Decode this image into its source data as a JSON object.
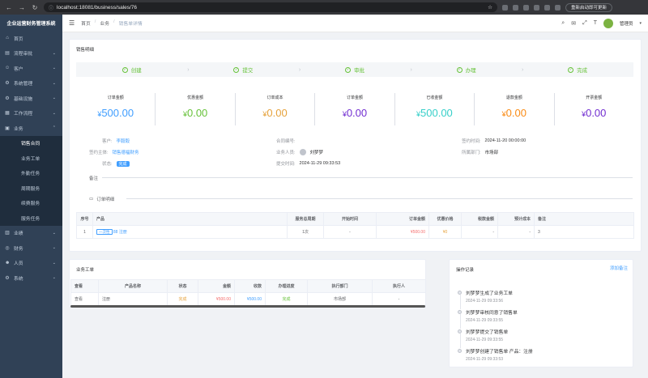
{
  "browser": {
    "url": "localhost:18081/business/sales/76",
    "update_label": "重新启动即可更新"
  },
  "sidebar": {
    "title": "企业运营财务管理系统",
    "items": [
      {
        "label": "首页",
        "icon": "home-icon"
      },
      {
        "label": "流程审批",
        "icon": "flow-icon"
      },
      {
        "label": "客户",
        "icon": "user-icon"
      },
      {
        "label": "系统管理",
        "icon": "gear-icon"
      },
      {
        "label": "基础设施",
        "icon": "gear-icon"
      },
      {
        "label": "工作流程",
        "icon": "flow-icon"
      },
      {
        "label": "业务",
        "icon": "folder-icon"
      }
    ],
    "sub_items": [
      "销售合同",
      "业务工单",
      "外勤任务",
      "周期服务",
      "续费服务",
      "服务任务"
    ],
    "bottom_items": [
      {
        "label": "业绩",
        "icon": "chart-icon"
      },
      {
        "label": "财务",
        "icon": "money-icon"
      },
      {
        "label": "人员",
        "icon": "people-icon"
      },
      {
        "label": "系统",
        "icon": "gear-icon"
      }
    ]
  },
  "header": {
    "breadcrumb": [
      "首页",
      "业务",
      "销售单详情"
    ],
    "user_name": "管理员"
  },
  "sales": {
    "card_title": "销售明细",
    "steps": [
      "创建",
      "提交",
      "审批",
      "办理",
      "完成"
    ],
    "amounts": [
      {
        "label": "订单金额",
        "currency": "¥",
        "value": "500.00",
        "color": "#409eff"
      },
      {
        "label": "优惠金额",
        "currency": "¥",
        "value": "0.00",
        "color": "#67c23a"
      },
      {
        "label": "订单成本",
        "currency": "¥",
        "value": "0.00",
        "color": "#e6a23c"
      },
      {
        "label": "订单金额",
        "currency": "¥",
        "value": "0.00",
        "color": "#722ed1"
      },
      {
        "label": "已收金额",
        "currency": "¥",
        "value": "500.00",
        "color": "#36cfc9"
      },
      {
        "label": "退款金额",
        "currency": "¥",
        "value": "0.00",
        "color": "#fa8c16"
      },
      {
        "label": "开票金额",
        "currency": "¥",
        "value": "0.00",
        "color": "#722ed1"
      }
    ],
    "info": {
      "customer_label": "客户:",
      "customer_value": "李毅毅",
      "contract_label": "合同编号:",
      "contract_value": "",
      "sign_time_label": "签约时间:",
      "sign_time_value": "2024-11-20 00:00:00",
      "subject_label": "签约主体:",
      "subject_value": "销售德福财务",
      "staff_label": "业务人员:",
      "staff_value": "刘梦梦",
      "dept_label": "所属部门:",
      "dept_value": "市场部",
      "status_label": "状态:",
      "status_value": "完成",
      "submit_label": "提交时间:",
      "submit_value": "2024-11-29 09:33:53"
    },
    "remark_label": "备注",
    "order_detail_label": "订单明细",
    "detail_headers": [
      "序号",
      "产品",
      "服务总周期",
      "开始时间",
      "订单金额",
      "优惠价格",
      "税款金额",
      "预计成本",
      "备注"
    ],
    "detail_rows": [
      {
        "no": "1",
        "tag": "一次性",
        "product": "88 注册",
        "period": "1次",
        "start": "-",
        "amount": "¥500.00",
        "discount": "¥0",
        "tax": "-",
        "cost": "-",
        "remark": "3"
      }
    ]
  },
  "work_orders": {
    "title": "业务工单",
    "headers": [
      "查看",
      "产品名称",
      "状态",
      "金额",
      "收款",
      "办理进度",
      "执行部门",
      "执行人"
    ],
    "rows": [
      {
        "view": "查看",
        "product": "注册",
        "status": "完成",
        "amount": "¥500.00",
        "received": "¥500.00",
        "progress": "完成",
        "dept": "市场部",
        "executor": "-"
      }
    ]
  },
  "ops_log": {
    "title": "操作记录",
    "add_label": "添加备注",
    "entries": [
      {
        "text": "刘梦梦生成了业务工单",
        "time": "2024-11-29 09:33:56"
      },
      {
        "text": "刘梦梦审核同意了销售单",
        "time": "2024-11-29 09:33:55"
      },
      {
        "text": "刘梦梦提交了销售单",
        "time": "2024-11-29 09:33:55"
      },
      {
        "text": "刘梦梦创建了销售单 产品：注册",
        "time": "2024-11-29 09:33:53"
      }
    ]
  }
}
